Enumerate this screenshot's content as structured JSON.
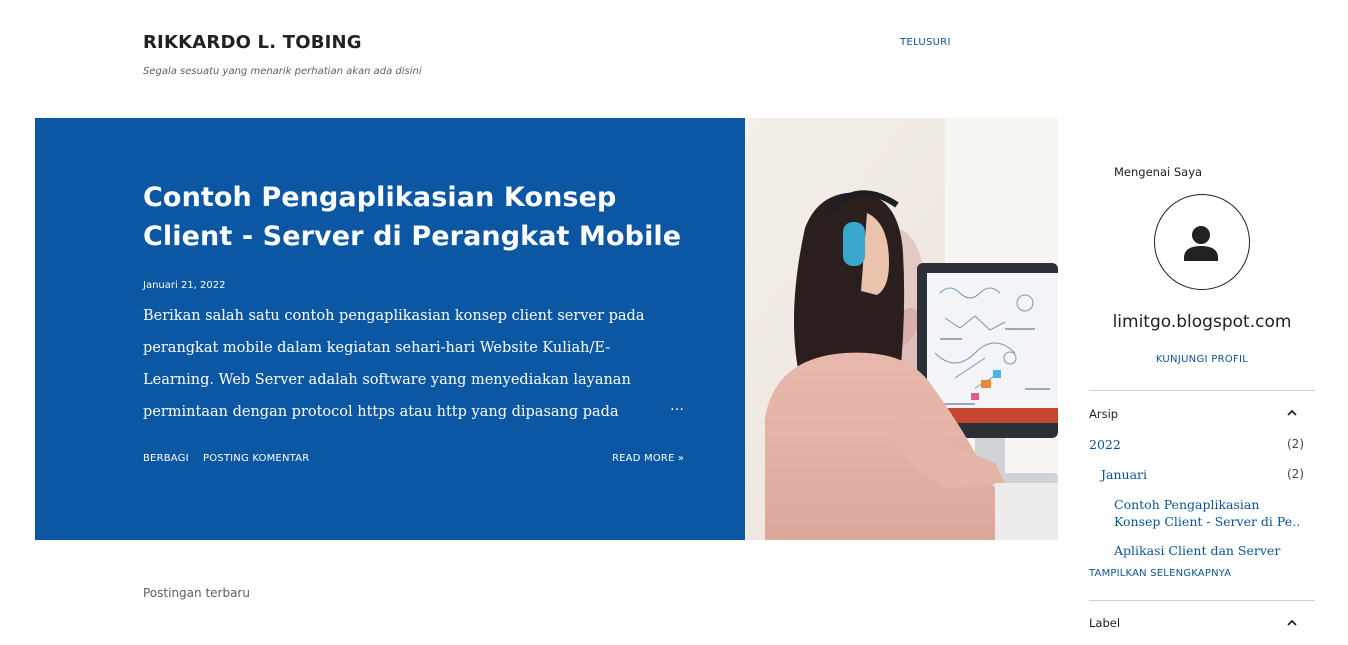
{
  "header": {
    "blog_title": "RIKKARDO L. TOBING",
    "description": "Segala sesuatu yang menarik perhatian akan ada disini",
    "nav_link": "TELUSURI"
  },
  "featured_post": {
    "title": "Contoh Pengaplikasian Konsep Client - Server di Perangkat Mobile",
    "date": "Januari 21, 2022",
    "snippet": "Berikan salah satu contoh pengaplikasian konsep client server pada perangkat mobile dalam kegiatan sehari-hari Website Kuliah/E-Learning. Web Server adalah software yang menyediakan layanan permintaan dengan protocol https atau http yang dipasang pada",
    "ellipsis": "…",
    "share_label": "BERBAGI",
    "comment_label": "POSTING KOMENTAR",
    "read_more_label": "READ MORE »",
    "background_color": "#0b57a4"
  },
  "main": {
    "recent_posts_label": "Postingan terbaru"
  },
  "sidebar": {
    "about_heading": "Mengenai Saya",
    "profile_name": "limitgo.blogspot.com",
    "profile_link": "KUNJUNGI PROFIL",
    "archive": {
      "heading": "Arsip",
      "year": {
        "label": "2022",
        "count": "(2)"
      },
      "month": {
        "label": "Januari",
        "count": "(2)"
      },
      "posts": [
        {
          "line1": "Contoh Pengaplikasian",
          "line2": "Konsep Client - Server di Pe…"
        },
        {
          "line1": "Aplikasi Client dan Server"
        }
      ],
      "show_more": "TAMPILKAN SELENGKAPNYA"
    },
    "label_heading": "Label"
  },
  "icons": {
    "avatar": "person-icon",
    "archive_toggle": "chevron-up-icon",
    "label_toggle": "chevron-up-icon"
  },
  "colors": {
    "accent": "#0b5394",
    "hero": "#0b57a4"
  }
}
